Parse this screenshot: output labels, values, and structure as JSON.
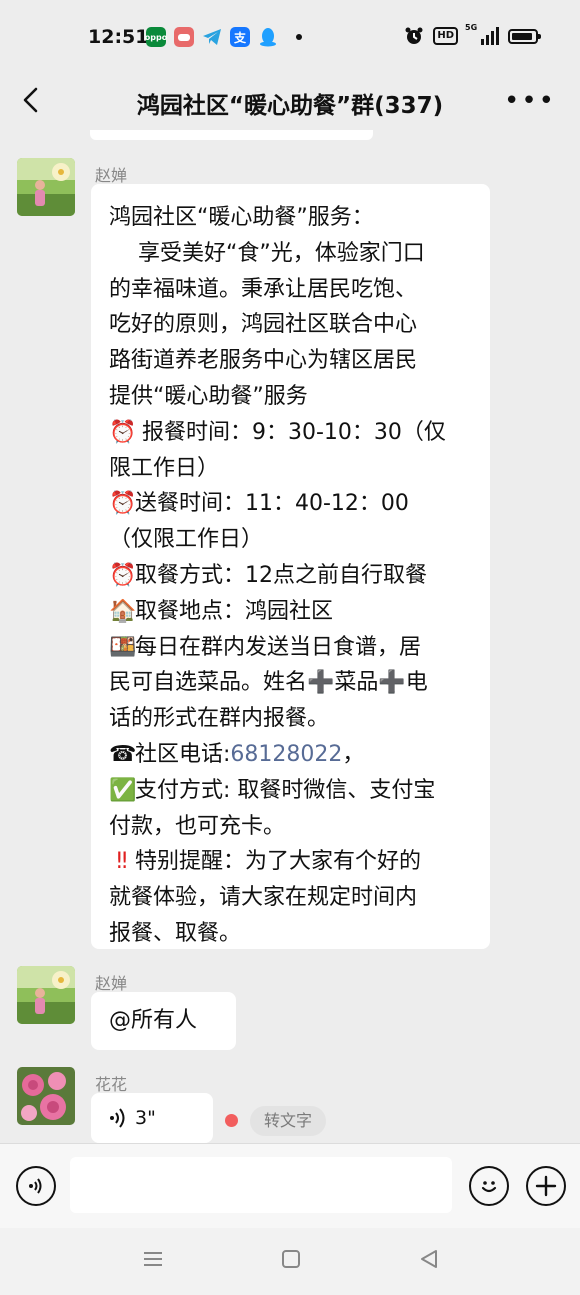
{
  "status_bar": {
    "time": "12:51",
    "apps": [
      {
        "icon": "oppo-app-icon",
        "label": "oppo",
        "color": "#0a8a3a"
      },
      {
        "icon": "game-icon",
        "label": "",
        "color": "#e86a6a"
      },
      {
        "icon": "telegram-icon",
        "label": "",
        "color": "#2aa3e0"
      },
      {
        "icon": "alipay-icon",
        "label": "支",
        "color": "#1677ff"
      },
      {
        "icon": "qq-icon",
        "label": "",
        "color": "#20a0ff"
      }
    ],
    "hd": "HD",
    "network": "5G"
  },
  "header": {
    "title": "鸿园社区“暖心助餐”群(337)"
  },
  "messages": [
    {
      "sender": "赵婵",
      "lines": [
        {
          "text": "鸿园社区“暖心助餐”服务："
        },
        {
          "text": "　 享受美好“食”光，体验家门口"
        },
        {
          "text": "的幸福味道。秉承让居民吃饱、"
        },
        {
          "text": "吃好的原则，鸿园社区联合中心"
        },
        {
          "text": "路街道养老服务中心为辖区居民"
        },
        {
          "text": "提供“暖心助餐”服务"
        },
        {
          "emoji": "⏰",
          "text": " 报餐时间：9：30-10：30（仅"
        },
        {
          "text": "限工作日）"
        },
        {
          "emoji": "⏰",
          "text": "送餐时间：11：40-12：00"
        },
        {
          "text": "（仅限工作日）"
        },
        {
          "emoji": "⏰",
          "text": "取餐方式：12点之前自行取餐"
        },
        {
          "emoji": "🏠",
          "text": "取餐地点：鸿园社区"
        },
        {
          "emoji": "🍱",
          "text": "每日在群内发送当日食谱，居"
        },
        {
          "text": "民可自选菜品。姓名➕菜品➕电"
        },
        {
          "text": "话的形式在群内报餐。"
        },
        {
          "emoji": "☎",
          "text": "社区电话:",
          "link": "68128022",
          "after": "，"
        },
        {
          "emoji": "✅",
          "text": "支付方式: 取餐时微信、支付宝"
        },
        {
          "text": "付款，也可充卡。"
        },
        {
          "emoji": "‼",
          "text": "特别提醒：为了大家有个好的"
        },
        {
          "text": "就餐体验，请大家在规定时间内"
        },
        {
          "text": "报餐、取餐。"
        }
      ]
    },
    {
      "sender": "赵婵",
      "text": "@所有人"
    },
    {
      "sender": "花花",
      "voice_duration": "3\"",
      "convert_label": "转文字"
    }
  ]
}
